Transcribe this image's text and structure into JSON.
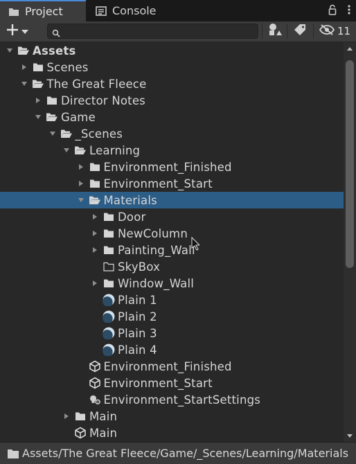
{
  "tabs": {
    "project_label": "Project",
    "project_icon": "folder-icon",
    "console_label": "Console",
    "console_icon": "console-icon"
  },
  "toolbar": {
    "add_icon": "plus-icon",
    "search_placeholder": "",
    "search_value": "",
    "hidden_count": "11"
  },
  "tree": [
    {
      "label": "Assets",
      "depth": 0,
      "expanded": true,
      "icon": "folder-open",
      "bold": true
    },
    {
      "label": "Scenes",
      "depth": 1,
      "expanded": false,
      "icon": "folder"
    },
    {
      "label": "The Great Fleece",
      "depth": 1,
      "expanded": true,
      "icon": "folder-open"
    },
    {
      "label": "Director Notes",
      "depth": 2,
      "expanded": false,
      "icon": "folder"
    },
    {
      "label": "Game",
      "depth": 2,
      "expanded": true,
      "icon": "folder-open"
    },
    {
      "label": "_Scenes",
      "depth": 3,
      "expanded": true,
      "icon": "folder-open"
    },
    {
      "label": "Learning",
      "depth": 4,
      "expanded": true,
      "icon": "folder-open"
    },
    {
      "label": "Environment_Finished",
      "depth": 5,
      "expanded": false,
      "icon": "folder"
    },
    {
      "label": "Environment_Start",
      "depth": 5,
      "expanded": false,
      "icon": "folder"
    },
    {
      "label": "Materials",
      "depth": 5,
      "expanded": true,
      "icon": "folder-open",
      "selected": true
    },
    {
      "label": "Door",
      "depth": 6,
      "expanded": false,
      "icon": "folder"
    },
    {
      "label": "NewColumn",
      "depth": 6,
      "expanded": false,
      "icon": "folder"
    },
    {
      "label": "Painting_Wall",
      "depth": 6,
      "expanded": false,
      "icon": "folder"
    },
    {
      "label": "SkyBox",
      "depth": 6,
      "expanded": null,
      "icon": "folder-empty"
    },
    {
      "label": "Window_Wall",
      "depth": 6,
      "expanded": false,
      "icon": "folder"
    },
    {
      "label": "Plain 1",
      "depth": 6,
      "expanded": null,
      "icon": "material"
    },
    {
      "label": "Plain 2",
      "depth": 6,
      "expanded": null,
      "icon": "material"
    },
    {
      "label": "Plain 3",
      "depth": 6,
      "expanded": null,
      "icon": "material"
    },
    {
      "label": "Plain 4",
      "depth": 6,
      "expanded": null,
      "icon": "material"
    },
    {
      "label": "Environment_Finished",
      "depth": 5,
      "expanded": null,
      "icon": "unity-scene"
    },
    {
      "label": "Environment_Start",
      "depth": 5,
      "expanded": null,
      "icon": "unity-scene"
    },
    {
      "label": "Environment_StartSettings",
      "depth": 5,
      "expanded": null,
      "icon": "lighting-settings"
    },
    {
      "label": "Main",
      "depth": 4,
      "expanded": false,
      "icon": "folder"
    },
    {
      "label": "Main",
      "depth": 4,
      "expanded": null,
      "icon": "unity-scene"
    }
  ],
  "status": {
    "path": "Assets/The Great Fleece/Game/_Scenes/Learning/Materials"
  },
  "colors": {
    "selection": "#2c5d87",
    "accent": "#4a8ad9",
    "background": "#282828"
  }
}
